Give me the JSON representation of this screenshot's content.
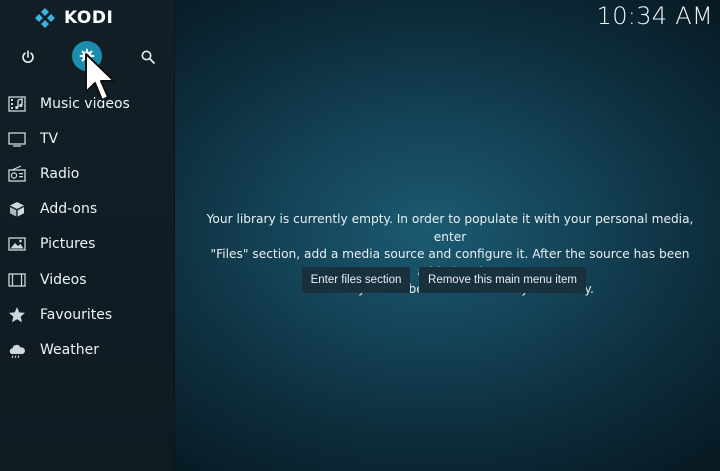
{
  "app": {
    "brand": "KODI"
  },
  "clock": {
    "time": "10:34 AM"
  },
  "top_icons": [
    {
      "name": "power-icon"
    },
    {
      "name": "settings-gear-icon"
    },
    {
      "name": "search-icon"
    }
  ],
  "menu": {
    "items": [
      {
        "label": "Music videos",
        "icon": "music-video-icon"
      },
      {
        "label": "TV",
        "icon": "tv-icon"
      },
      {
        "label": "Radio",
        "icon": "radio-icon"
      },
      {
        "label": "Add-ons",
        "icon": "addons-box-icon"
      },
      {
        "label": "Pictures",
        "icon": "pictures-icon"
      },
      {
        "label": "Videos",
        "icon": "film-icon"
      },
      {
        "label": "Favourites",
        "icon": "star-icon"
      },
      {
        "label": "Weather",
        "icon": "weather-cloud-icon"
      }
    ]
  },
  "main": {
    "message_line1": "Your library is currently empty. In order to populate it with your personal media, enter",
    "message_line2": "\"Files\" section, add a media source and configure it. After the source has been added and",
    "message_line3": "indexed you will be able to browse your library.",
    "buttons": {
      "enter_files": "Enter files section",
      "remove_item": "Remove this main menu item"
    }
  },
  "colors": {
    "accent": "#1a8cae",
    "sidebar_bg": "#121f27",
    "button_bg": "#19313c"
  }
}
